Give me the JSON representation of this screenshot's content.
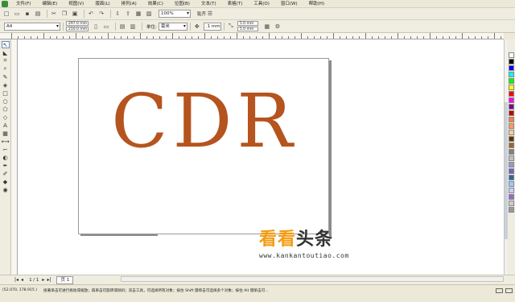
{
  "menubar": {
    "items": [
      "文件(F)",
      "编辑(E)",
      "视图(V)",
      "版面(L)",
      "排列(A)",
      "效果(C)",
      "位图(B)",
      "文本(T)",
      "表格(T)",
      "工具(O)",
      "窗口(W)",
      "帮助(H)"
    ]
  },
  "toolbar": {
    "zoom": "100%",
    "snap_label": "贴齐"
  },
  "propbar": {
    "paper": "A4",
    "width": "297.0 mm",
    "height": "210.0 mm",
    "units_label": "单位:",
    "units": "毫米",
    "nudge": ".1 mm",
    "dup_x": "5.0 mm",
    "dup_y": "5.0 mm"
  },
  "canvas": {
    "text": "CDR",
    "text_color": "#b5541e"
  },
  "watermark": {
    "text_a": "看看",
    "text_b": "头条",
    "url": "www.kankantoutiao.com"
  },
  "pagebar": {
    "page_count": "1 / 1",
    "page_tab": "页 1"
  },
  "status": {
    "coords": "(52.070, 178.915 )",
    "hint": "接著单击可进行拖动或缩放；再单击可旋转或倾斜；双击工具，可选择所有对象；按住 Shift 键单击可选择多个对象；按住 Alt 键单击可..."
  },
  "palette_colors": [
    "#ffffff",
    "#000000",
    "#0000ff",
    "#00ffff",
    "#00ff00",
    "#ffff00",
    "#ff0000",
    "#ff00ff",
    "#800080",
    "#c00000",
    "#ff8040",
    "#ff9966",
    "#ffcc99",
    "#663300",
    "#996633",
    "#808080",
    "#c0c0c0",
    "#9999cc",
    "#6666cc",
    "#336699",
    "#99ccff",
    "#ccccff",
    "#9966cc",
    "#cccccc",
    "#999999"
  ]
}
